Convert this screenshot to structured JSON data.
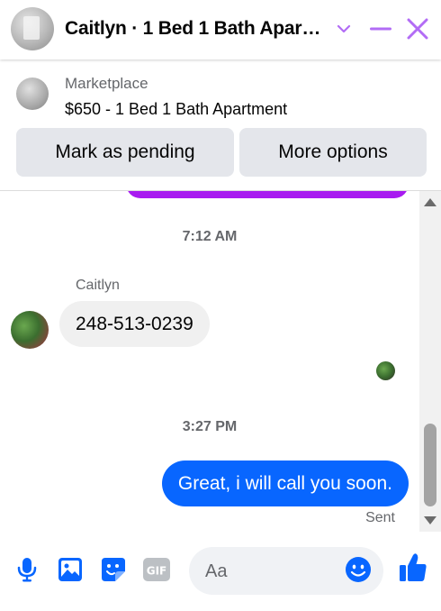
{
  "header": {
    "title": "Caitlyn · 1 Bed 1 Bath Apar…",
    "colors": {
      "accent": "#b26cf5"
    }
  },
  "listing": {
    "source": "Marketplace",
    "item": "$650 - 1 Bed 1 Bath Apartment",
    "buttons": {
      "pending": "Mark as pending",
      "more": "More options"
    }
  },
  "thread": {
    "timestamps": [
      "7:12 AM",
      "3:27 PM"
    ],
    "incoming": {
      "sender": "Caitlyn",
      "text": "248-513-0239"
    },
    "outgoing": {
      "text": "Great, i will call you soon.",
      "status": "Sent"
    },
    "colors": {
      "outgoing_bubble": "#0866ff",
      "incoming_bubble": "#f0f0f0",
      "previous_bubble": "#a81bf0"
    }
  },
  "composer": {
    "placeholder": "Aa",
    "icons": [
      "microphone-icon",
      "photo-icon",
      "sticker-icon",
      "gif-icon",
      "emoji-icon",
      "thumbs-up-icon"
    ],
    "colors": {
      "icon": "#0866ff"
    }
  }
}
